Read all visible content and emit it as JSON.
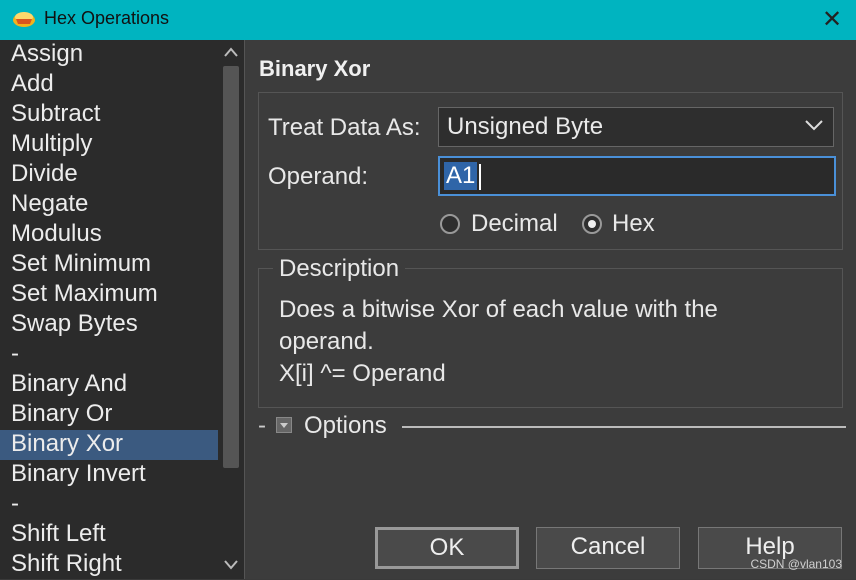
{
  "window": {
    "title": "Hex Operations"
  },
  "operations": [
    "Assign",
    "Add",
    "Subtract",
    "Multiply",
    "Divide",
    "Negate",
    "Modulus",
    "Set Minimum",
    "Set Maximum",
    "Swap Bytes",
    "-",
    "Binary And",
    "Binary Or",
    "Binary Xor",
    "Binary Invert",
    "-",
    "Shift Left",
    "Shift Right"
  ],
  "selected_operation": "Binary Xor",
  "panel": {
    "title": "Binary Xor",
    "treat_label": "Treat Data As:",
    "treat_value": "Unsigned Byte",
    "operand_label": "Operand:",
    "operand_value": "A1",
    "radio_decimal": "Decimal",
    "radio_hex": "Hex",
    "radio_selected": "Hex"
  },
  "description": {
    "legend": "Description",
    "line1": "Does a bitwise Xor of each value with the",
    "line2": "operand.",
    "line3": "X[i] ^= Operand"
  },
  "options": {
    "dash": "-",
    "label": "Options"
  },
  "buttons": {
    "ok": "OK",
    "cancel": "Cancel",
    "help": "Help"
  },
  "watermark": "CSDN @vlan103",
  "colors": {
    "titlebar": "#00b4c0",
    "selection": "#3b5a80",
    "focus": "#4a90d8"
  }
}
